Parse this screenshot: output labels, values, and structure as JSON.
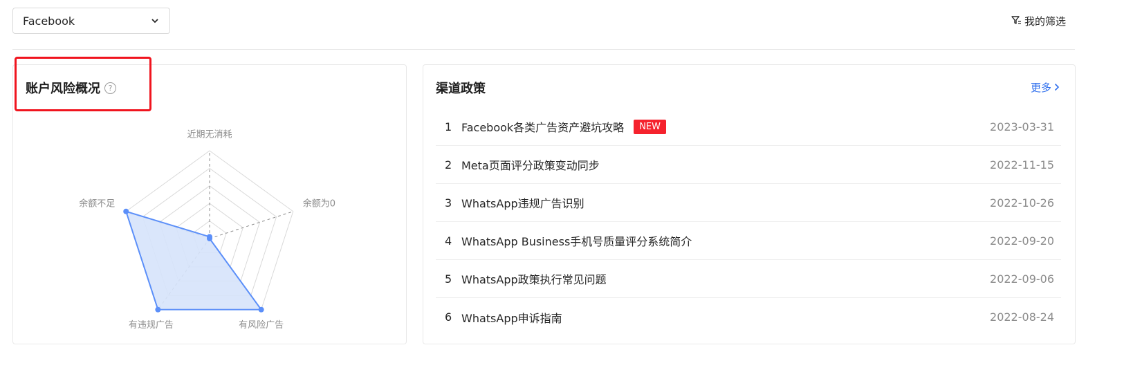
{
  "platform_select": {
    "value": "Facebook"
  },
  "filter": {
    "label": "我的筛选"
  },
  "risk_card": {
    "title": "账户风险概况",
    "help": "?",
    "radar": {
      "type": "radar",
      "axes": [
        "近期无消耗",
        "余额为0",
        "有风险广告",
        "有违规广告",
        "余额不足"
      ],
      "values": [
        0.02,
        0.0,
        1.0,
        1.0,
        1.0
      ],
      "range": [
        0,
        1
      ],
      "fill_color": "#d6e3fb",
      "line_color": "#5b8ff9"
    }
  },
  "policy_card": {
    "title": "渠道政策",
    "more_label": "更多",
    "items": [
      {
        "index": "1",
        "title": "Facebook各类广告资产避坑攻略",
        "badge": "NEW",
        "date": "2023-03-31"
      },
      {
        "index": "2",
        "title": "Meta页面评分政策变动同步",
        "badge": "",
        "date": "2022-11-15"
      },
      {
        "index": "3",
        "title": "WhatsApp违规广告识别",
        "badge": "",
        "date": "2022-10-26"
      },
      {
        "index": "4",
        "title": "WhatsApp Business手机号质量评分系统简介",
        "badge": "",
        "date": "2022-09-20"
      },
      {
        "index": "5",
        "title": "WhatsApp政策执行常见问题",
        "badge": "",
        "date": "2022-09-06"
      },
      {
        "index": "6",
        "title": "WhatsApp申诉指南",
        "badge": "",
        "date": "2022-08-24"
      }
    ]
  }
}
